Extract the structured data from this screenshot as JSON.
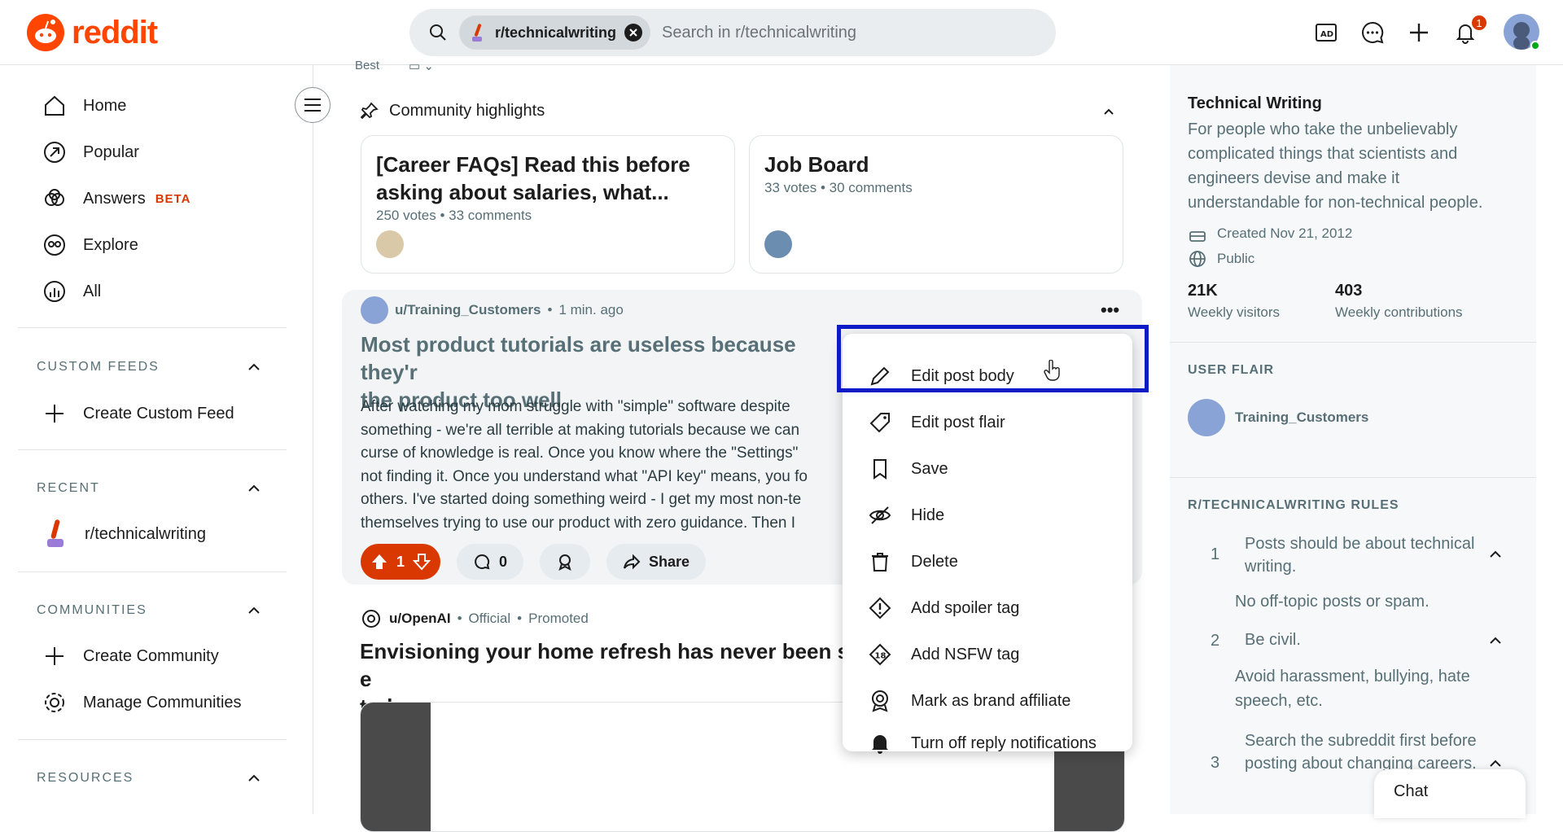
{
  "header": {
    "logo_text": "reddit",
    "search_chip": "r/technicalwriting",
    "search_placeholder": "Search in r/technicalwriting",
    "notification_count": "1",
    "brand_color": "#ff4500"
  },
  "sidebar": {
    "nav": [
      {
        "label": "Home",
        "icon": "home-icon"
      },
      {
        "label": "Popular",
        "icon": "popular-icon"
      },
      {
        "label": "Answers",
        "icon": "answers-icon",
        "badge": "BETA"
      },
      {
        "label": "Explore",
        "icon": "explore-icon"
      },
      {
        "label": "All",
        "icon": "all-icon"
      }
    ],
    "custom_feeds": {
      "title": "CUSTOM FEEDS",
      "items": [
        "Create Custom Feed"
      ]
    },
    "recent": {
      "title": "RECENT",
      "items": [
        "r/technicalwriting"
      ]
    },
    "communities": {
      "title": "COMMUNITIES",
      "items": [
        "Create Community",
        "Manage Communities"
      ]
    },
    "resources": {
      "title": "RESOURCES"
    }
  },
  "feed": {
    "sort": "Best",
    "highlights_title": "Community highlights",
    "highlights": [
      {
        "title": "[Career FAQs] Read this before asking about salaries, what...",
        "votes": "250 votes",
        "comments": "33 comments"
      },
      {
        "title": "Job Board",
        "votes": "33 votes",
        "comments": "30 comments"
      }
    ],
    "post": {
      "author": "u/Training_Customers",
      "time": "1 min. ago",
      "title": "Most product tutorials are useless because they'r the product too well",
      "title_line1": "Most product tutorials are useless because they'r",
      "title_line2": "the product too well",
      "body_lines": [
        "After watching my mom struggle with \"simple\" software despite",
        "something - we're all terrible at making tutorials because we can",
        "curse of knowledge is real. Once you know where the \"Settings\"",
        "not finding it. Once you understand what \"API key\" means, you fo",
        "others. I've started doing something weird - I get my most non-te",
        "themselves trying to use our product with zero guidance. Then I"
      ],
      "votes": "1",
      "comments": "0",
      "share": "Share"
    },
    "promo": {
      "author": "u/OpenAI",
      "official": "Official",
      "promoted": "Promoted",
      "title_line1": "Envisioning your home refresh has never been so e",
      "title_line2": "today."
    }
  },
  "menu": {
    "items": [
      {
        "label": "Edit post body",
        "icon": "pencil-icon"
      },
      {
        "label": "Edit post flair",
        "icon": "tag-icon"
      },
      {
        "label": "Save",
        "icon": "bookmark-icon"
      },
      {
        "label": "Hide",
        "icon": "eye-slash-icon"
      },
      {
        "label": "Delete",
        "icon": "trash-icon"
      },
      {
        "label": "Add spoiler tag",
        "icon": "spoiler-icon"
      },
      {
        "label": "Add NSFW tag",
        "icon": "nsfw-icon"
      },
      {
        "label": "Mark as brand affiliate",
        "icon": "brand-affiliate-icon"
      },
      {
        "label": "Turn off reply notifications",
        "icon": "bell-icon"
      }
    ],
    "highlight_color": "#0b1cc7"
  },
  "community": {
    "title": "Technical Writing",
    "description": "For people who take the unbelievably complicated things that scientists and engineers devise and make it understandable for non-technical people.",
    "created": "Created Nov 21, 2012",
    "visibility": "Public",
    "stats": [
      {
        "value": "21K",
        "label": "Weekly visitors"
      },
      {
        "value": "403",
        "label": "Weekly contributions"
      }
    ],
    "user_flair_title": "USER FLAIR",
    "user_flair_name": "Training_Customers",
    "rules_title": "R/TECHNICALWRITING RULES",
    "rules": [
      {
        "num": "1",
        "title": "Posts should be about technical writing.",
        "desc": "No off-topic posts or spam."
      },
      {
        "num": "2",
        "title": "Be civil.",
        "desc": "Avoid harassment, bullying, hate speech, etc."
      },
      {
        "num": "3",
        "title": "Search the subreddit first before posting about changing careers."
      }
    ]
  },
  "chat": {
    "label": "Chat"
  }
}
